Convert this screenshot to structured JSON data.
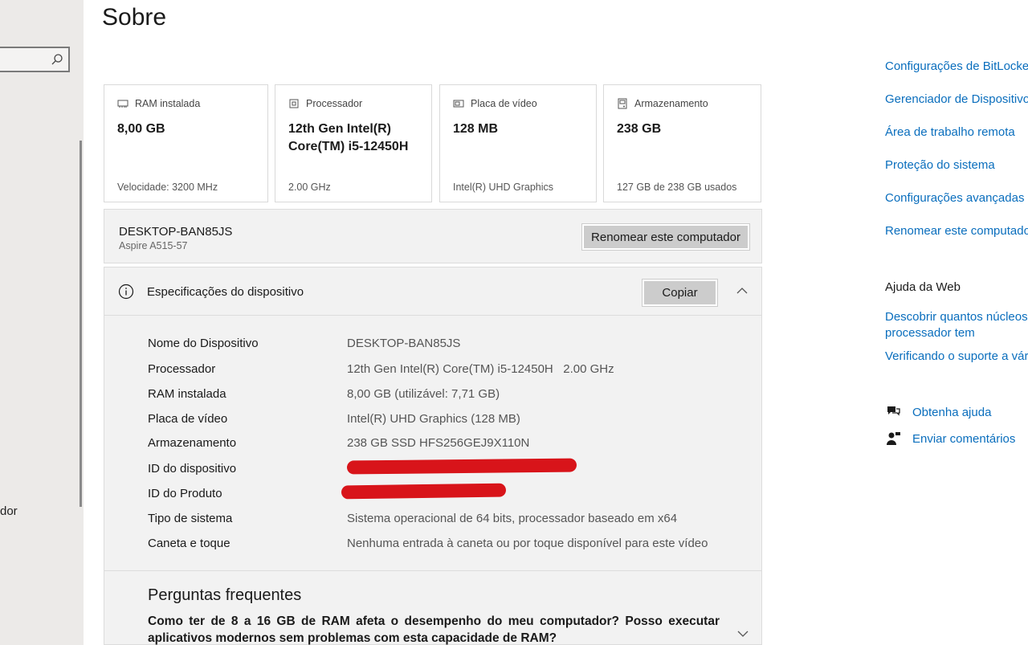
{
  "page": {
    "title": "Sobre"
  },
  "sidebar": {
    "truncated_label": "dor"
  },
  "cards": [
    {
      "label": "RAM instalada",
      "value": "8,00 GB",
      "sub": "Velocidade: 3200 MHz",
      "icon": "ram-icon"
    },
    {
      "label": "Processador",
      "value": "12th Gen Intel(R) Core(TM) i5-12450H",
      "sub": "2.00 GHz",
      "icon": "processor-icon"
    },
    {
      "label": "Placa de vídeo",
      "value": "128 MB",
      "sub": "Intel(R) UHD Graphics",
      "icon": "gpu-icon"
    },
    {
      "label": "Armazenamento",
      "value": "238 GB",
      "sub": "127 GB de 238 GB usados",
      "icon": "storage-icon"
    }
  ],
  "device": {
    "name": "DESKTOP-BAN85JS",
    "model": "Aspire A515-57",
    "rename_button": "Renomear este computador"
  },
  "specs": {
    "title": "Especificações do dispositivo",
    "copy_button": "Copiar",
    "rows": [
      {
        "key": "Nome do Dispositivo",
        "value": "DESKTOP-BAN85JS"
      },
      {
        "key": "Processador",
        "value": "12th Gen Intel(R) Core(TM) i5-12450H   2.00 GHz"
      },
      {
        "key": "RAM instalada",
        "value": "8,00 GB (utilizável: 7,71 GB)"
      },
      {
        "key": "Placa de vídeo",
        "value": "Intel(R) UHD Graphics (128 MB)"
      },
      {
        "key": "Armazenamento",
        "value": "238 GB SSD HFS256GEJ9X110N"
      },
      {
        "key": "ID do dispositivo",
        "value": ""
      },
      {
        "key": "ID do Produto",
        "value": ""
      },
      {
        "key": "Tipo de sistema",
        "value": "Sistema operacional de 64 bits, processador baseado em x64"
      },
      {
        "key": "Caneta e toque",
        "value": "Nenhuma entrada à caneta ou por toque disponível para este vídeo"
      }
    ]
  },
  "faq": {
    "title": "Perguntas frequentes",
    "question": "Como ter de 8 a 16 GB de RAM afeta o desempenho do meu computador? Posso executar aplicativos modernos sem problemas com esta capacidade de RAM?"
  },
  "related_links": [
    "Configurações de BitLocker",
    "Gerenciador de Dispositivos",
    "Área de trabalho remota",
    "Proteção do sistema",
    "Configurações avançadas d",
    "Renomear este computador"
  ],
  "web_help": {
    "title": "Ajuda da Web",
    "links": [
      "Descobrir quantos núcleos n processador tem",
      "Verificando o suporte a vári"
    ]
  },
  "support": {
    "get_help": "Obtenha ajuda",
    "feedback": "Enviar comentários"
  },
  "colors": {
    "accent": "#0a6ebd",
    "redaction": "#d8141a"
  }
}
